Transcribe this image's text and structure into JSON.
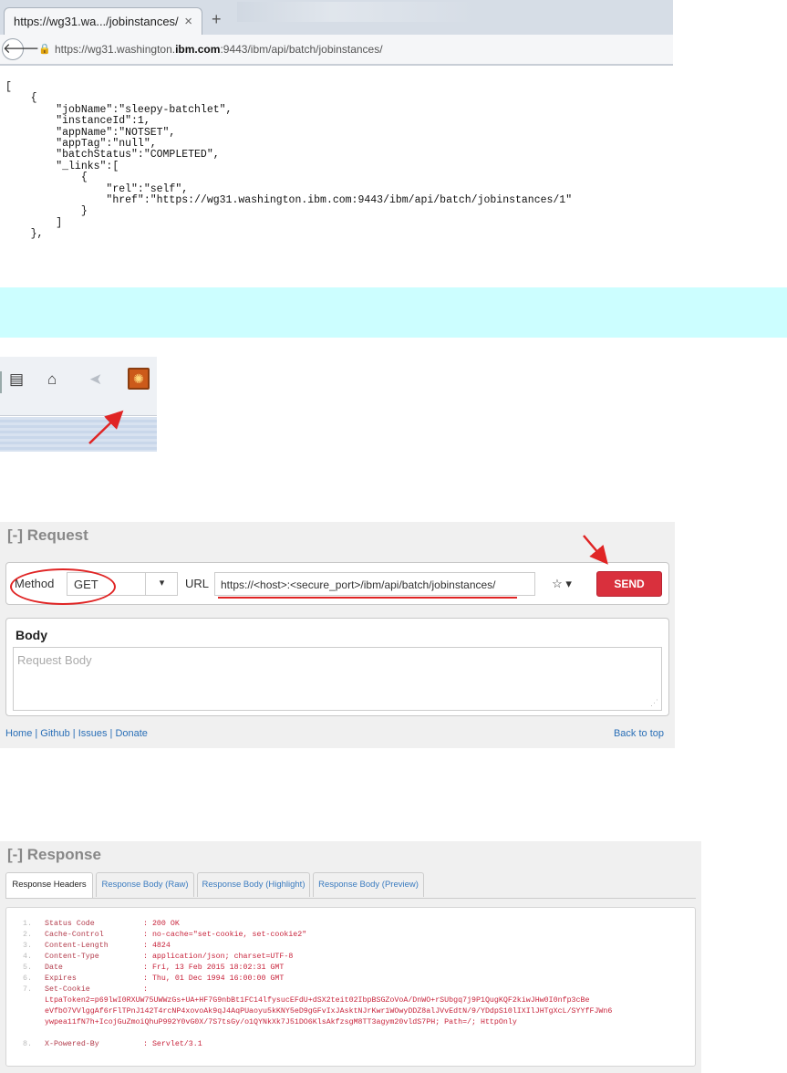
{
  "browser": {
    "tab_title": "https://wg31.wa.../jobinstances/",
    "tab_close": "×",
    "new_tab": "+",
    "back": "🡐",
    "lock": "🔒",
    "url_prefix": "https://wg31.washington.",
    "url_bold": "ibm.com",
    "url_suffix": ":9443/ibm/api/batch/jobinstances/"
  },
  "json_response": "[\n    {\n        \"jobName\":\"sleepy-batchlet\",\n        \"instanceId\":1,\n        \"appName\":\"NOTSET\",\n        \"appTag\":\"null\",\n        \"batchStatus\":\"COMPLETED\",\n        \"_links\":[\n            {\n                \"rel\":\"self\",\n                \"href\":\"https://wg31.washington.ibm.com:9443/ibm/api/batch/jobinstances/1\"\n            }\n        ]\n    },",
  "toolbar": {
    "icons": [
      "clipboard-list-icon",
      "home-icon",
      "send-icon",
      "restclient-plugin-icon"
    ],
    "clipboard": "▤",
    "home": "⌂",
    "send": "➤",
    "plugin": "✺"
  },
  "request": {
    "title": "[-] Request",
    "method_label": "Method",
    "method_value": "GET",
    "caret": "▾",
    "url_label": "URL",
    "url_value": "https://<host>:<secure_port>/ibm/api/batch/jobinstances/",
    "star_caret": "☆ ▾",
    "send_label": "SEND",
    "body_title": "Body",
    "body_placeholder": "Request Body",
    "footer_links": "Home | Github | Issues | Donate",
    "back_to_top": "Back to top"
  },
  "response": {
    "title": "[-] Response",
    "tabs": [
      "Response Headers",
      "Response Body (Raw)",
      "Response Body (Highlight)",
      "Response Body (Preview)"
    ],
    "headers": [
      {
        "n": "1.",
        "k": "Status Code",
        "v": ": 200 OK"
      },
      {
        "n": "2.",
        "k": "Cache-Control",
        "v": ": no-cache=\"set-cookie, set-cookie2\""
      },
      {
        "n": "3.",
        "k": "Content-Length",
        "v": ": 4824"
      },
      {
        "n": "4.",
        "k": "Content-Type",
        "v": ": application/json; charset=UTF-8"
      },
      {
        "n": "5.",
        "k": "Date",
        "v": ": Fri, 13 Feb 2015 18:02:31 GMT"
      },
      {
        "n": "6.",
        "k": "Expires",
        "v": ": Thu, 01 Dec 1994 16:00:00 GMT"
      },
      {
        "n": "7.",
        "k": "Set-Cookie",
        "v": ":"
      }
    ],
    "cookie_lines": [
      "LtpaToken2=p69lwI0RXUW75UWWzGs+UA+HF7G9nbBt1FC14lfysucEFdU+dSX2teit02IbpBSGZoVoA/DnWO+rSUbgq7j9P1QugKQF2kiwJHw0I0nfp3cBe",
      "eVfbO7VVlggAf6rFlTPnJ142T4rcNP4xovoAk9qJ4AqPUaoyu5kKNY5eD9gGFvIxJAsktNJrKwr1WOwyDDZ8alJVvEdtN/9/YDdpS10lIXIlJHTgXcL/SYYfFJWn6",
      "ywpea11fN7h+IcojGuZmoiQhuP992Y0vG0X/7S7tsGy/o1QYNkXk7J51DO6KlsAkfzsgM8TT3agym20vldS7PH; Path=/; HttpOnly"
    ],
    "last_header": {
      "n": "8.",
      "k": "X-Powered-By",
      "v": ": Servlet/3.1"
    }
  },
  "colors": {
    "band": "#ccfeff",
    "send_button": "#d9303d",
    "annotation_red": "#e02424",
    "link_blue": "#2a6fb7"
  }
}
